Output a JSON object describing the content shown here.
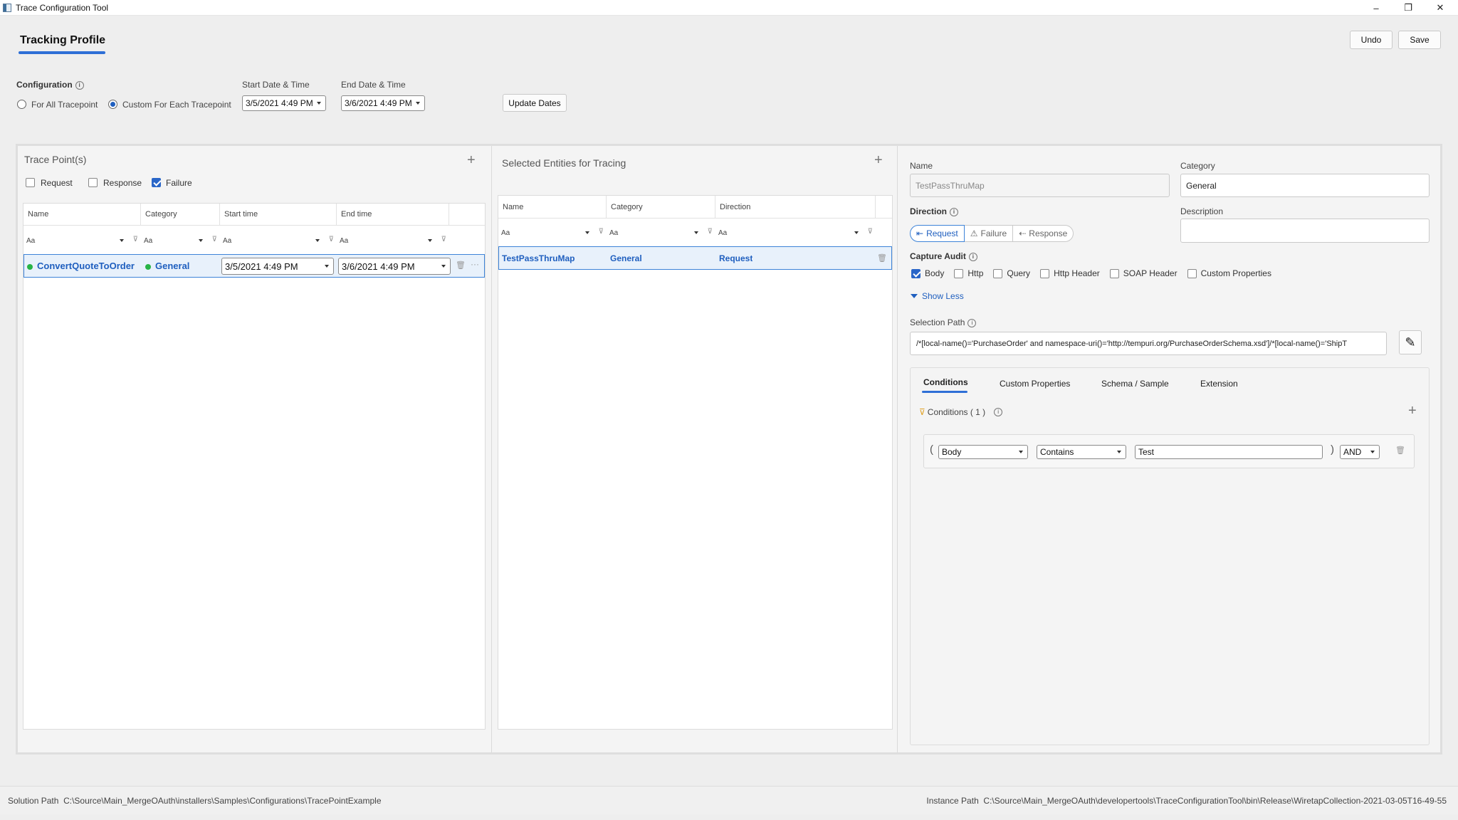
{
  "window": {
    "title": "Trace Configuration Tool",
    "minimize": "–",
    "restore": "❐",
    "close": "✕"
  },
  "profile": {
    "tab_label": "Tracking Profile",
    "undo_label": "Undo",
    "save_label": "Save"
  },
  "config": {
    "label": "Configuration",
    "option_all": "For All Tracepoint",
    "option_custom": "Custom For Each Tracepoint",
    "selected": "custom",
    "start_label": "Start Date & Time",
    "start_value": "3/5/2021 4:49 PM",
    "end_label": "End Date & Time",
    "end_value": "3/6/2021 4:49 PM",
    "update_label": "Update Dates"
  },
  "tracepoints": {
    "title": "Trace Point(s)",
    "add_icon": "+",
    "filters": [
      {
        "label": "Request",
        "checked": false
      },
      {
        "label": "Response",
        "checked": false
      },
      {
        "label": "Failure",
        "checked": true
      }
    ],
    "columns": [
      "Name",
      "Category",
      "Start time",
      "End time"
    ],
    "filter_placeholder": "Aa",
    "rows": [
      {
        "name": "ConvertQuoteToOrder",
        "category": "General",
        "start": "3/5/2021 4:49 PM",
        "end": "3/6/2021 4:49 PM",
        "more": "···"
      }
    ]
  },
  "entities": {
    "title": "Selected Entities for Tracing",
    "add_icon": "+",
    "columns": [
      "Name",
      "Category",
      "Direction"
    ],
    "filter_placeholder": "Aa",
    "rows": [
      {
        "name": "TestPassThruMap",
        "category": "General",
        "direction": "Request"
      }
    ]
  },
  "details": {
    "name_label": "Name",
    "name_value": "TestPassThruMap",
    "category_label": "Category",
    "category_value": "General",
    "direction_label": "Direction",
    "direction_options": [
      "Request",
      "Failure",
      "Response"
    ],
    "direction_selected": "Request",
    "description_label": "Description",
    "description_value": "",
    "capture_label": "Capture Audit",
    "capture_options": [
      {
        "label": "Body",
        "checked": true
      },
      {
        "label": "Http",
        "checked": false
      },
      {
        "label": "Query",
        "checked": false
      },
      {
        "label": "Http Header",
        "checked": false
      },
      {
        "label": "SOAP Header",
        "checked": false
      },
      {
        "label": "Custom Properties",
        "checked": false
      }
    ],
    "show_less_label": "Show Less",
    "selection_path_label": "Selection Path",
    "selection_path_value": "/*[local-name()='PurchaseOrder' and namespace-uri()='http://tempuri.org/PurchaseOrderSchema.xsd']/*[local-name()='ShipT",
    "tabs": [
      "Conditions",
      "Custom Properties",
      "Schema / Sample",
      "Extension"
    ],
    "active_tab": "Conditions",
    "conditions_header": "Conditions ( 1 )",
    "condition": {
      "open_paren": "(",
      "field": "Body",
      "operator": "Contains",
      "value": "Test",
      "close_paren": ")",
      "logic": "AND"
    }
  },
  "footer": {
    "solution_label": "Solution Path",
    "solution_value": "C:\\Source\\Main_MergeOAuth\\installers\\Samples\\Configurations\\TracePointExample",
    "instance_label": "Instance Path",
    "instance_value": "C:\\Source\\Main_MergeOAuth\\developertools\\TraceConfigurationTool\\bin\\Release\\WiretapCollection-2021-03-05T16-49-55"
  }
}
